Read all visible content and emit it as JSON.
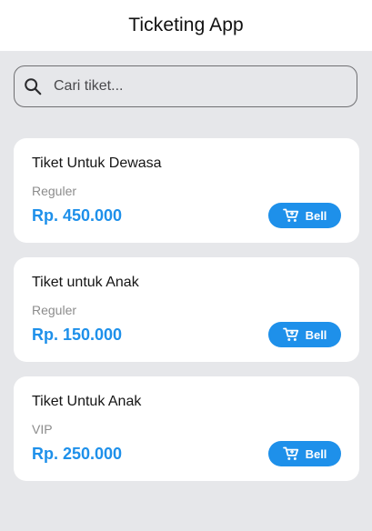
{
  "app": {
    "title": "Ticketing App"
  },
  "search": {
    "placeholder": "Cari tiket...",
    "value": "",
    "icon": "search-icon"
  },
  "colors": {
    "accent": "#1e90ea",
    "background": "#e6e7ea",
    "card": "#ffffff"
  },
  "tickets": [
    {
      "name": "Tiket Untuk Dewasa",
      "category": "Reguler",
      "price": "Rp. 450.000",
      "button_label": "Bell",
      "button_icon": "cart-plus-icon"
    },
    {
      "name": "Tiket untuk Anak",
      "category": "Reguler",
      "price": "Rp. 150.000",
      "button_label": "Bell",
      "button_icon": "cart-plus-icon"
    },
    {
      "name": "Tiket Untuk Anak",
      "category": "VIP",
      "price": "Rp. 250.000",
      "button_label": "Bell",
      "button_icon": "cart-plus-icon"
    }
  ]
}
